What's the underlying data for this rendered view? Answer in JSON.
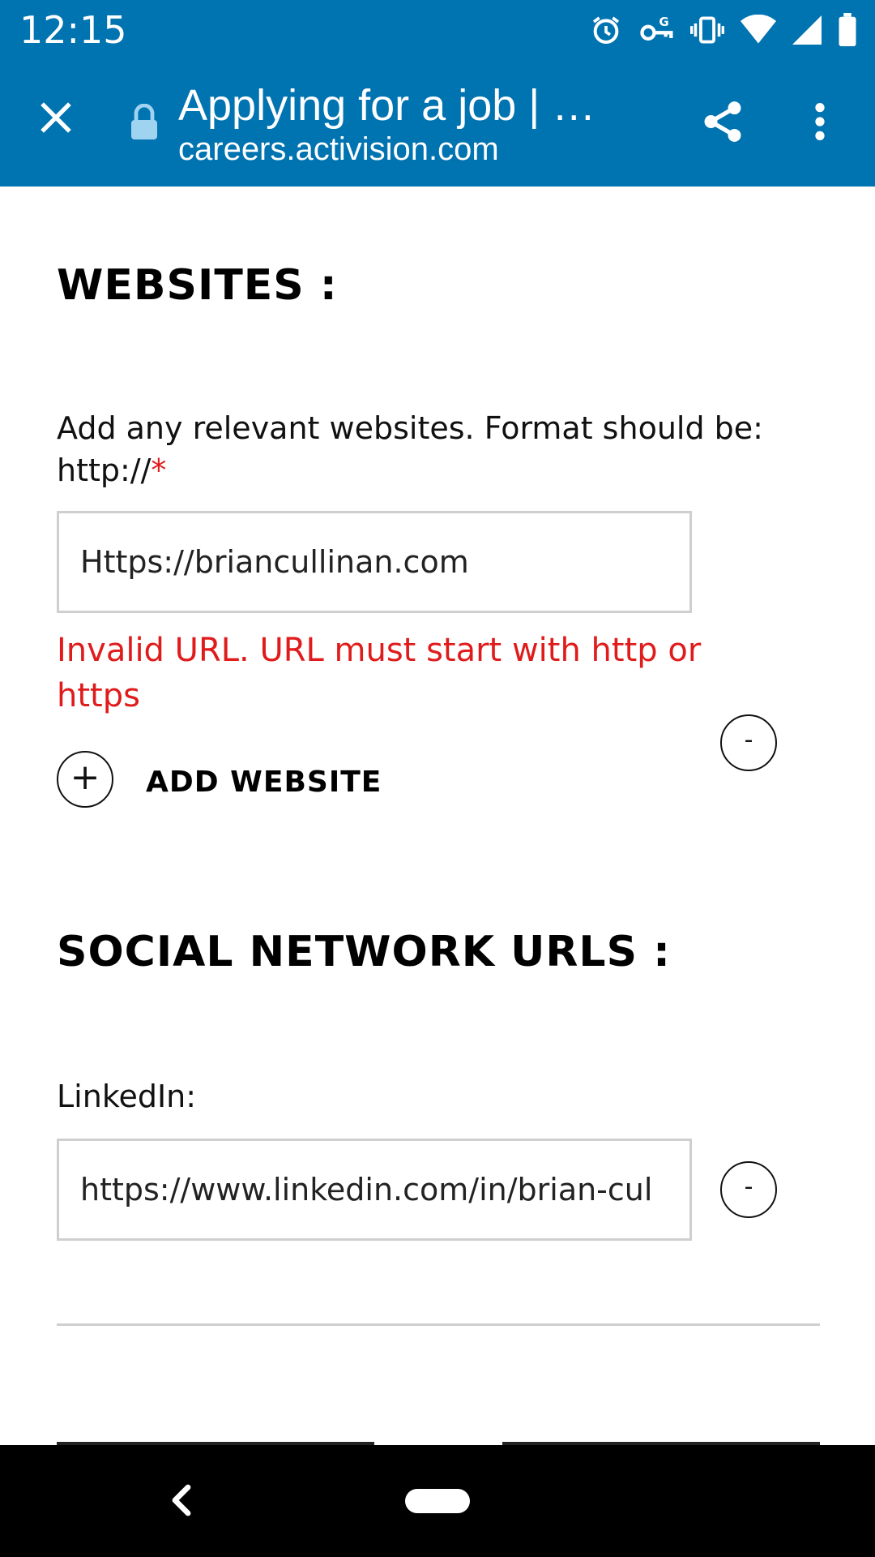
{
  "status_bar": {
    "time": "12:15",
    "icons": [
      "alarm-icon",
      "vpn-key-icon",
      "vibrate-icon",
      "wifi-icon",
      "cell-signal-icon",
      "battery-icon"
    ]
  },
  "toolbar": {
    "title": "Applying for a job | …",
    "url": "careers.activision.com",
    "icons": [
      "close-icon",
      "lock-icon",
      "share-icon",
      "more-vert-icon"
    ]
  },
  "websites": {
    "heading": "WEBSITES :",
    "label": "Add any relevant websites. Format should be: http://",
    "required_mark": "*",
    "input_value": "Https://briancullinan.com",
    "remove_label": "-",
    "error": "Invalid URL. URL must start with http or https",
    "add_icon": "+",
    "add_label": "ADD WEBSITE"
  },
  "social": {
    "heading": "SOCIAL NETWORK URLS :",
    "linkedin_label": "LinkedIn:",
    "linkedin_value": "https://www.linkedin.com/in/brian-cul",
    "remove_label": "-"
  },
  "colors": {
    "header_blue": "#0073b1",
    "error_red": "#e01b1b",
    "input_border": "#cfcfcf"
  }
}
